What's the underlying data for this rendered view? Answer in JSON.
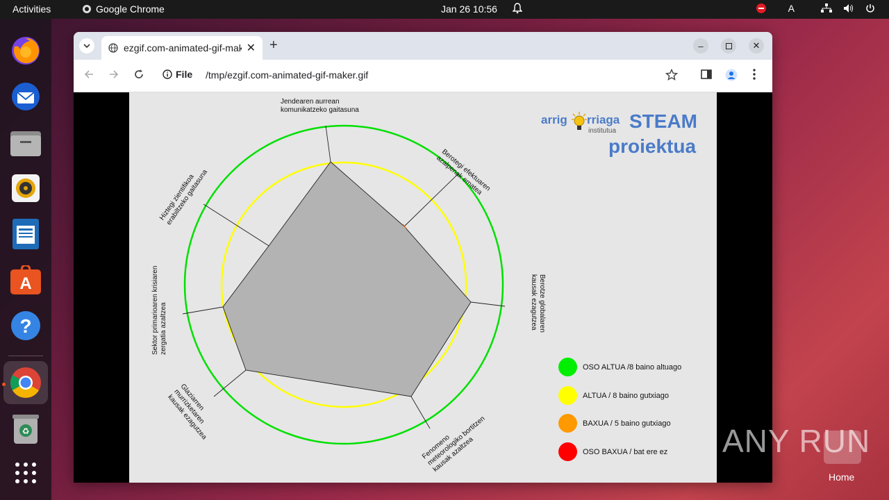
{
  "topbar": {
    "activities": "Activities",
    "app_name": "Google Chrome",
    "clock": "Jan 26  10:56",
    "lang": "A"
  },
  "dock": {
    "items": [
      "firefox-icon",
      "thunderbird-icon",
      "files-icon",
      "rhythmbox-icon",
      "writer-icon",
      "software-icon",
      "help-icon",
      "chrome-icon",
      "trash-icon",
      "apps-grid-icon"
    ]
  },
  "browser": {
    "tab_title": "ezgif.com-animated-gif-maker.gif",
    "address_label": "File",
    "address_url": "/tmp/ezgif.com-animated-gif-maker.gif"
  },
  "gif": {
    "logo_left": "arrig",
    "logo_right": "rriaga",
    "logo_sub": "institutua",
    "steam": "STEAM",
    "proiektua": "proiektua",
    "axes": [
      "Jendearen aurrean komunikatzeko gaitasuna",
      "Berotegi efektuaren azalpenak ematea",
      "Berotze globalaren kausak ezagutzea",
      "Fenomeno meteorologiko bortitzen kausak azaltzea",
      "Glaziarren murrizketaren kausak ezagutzea",
      "Sektor primarioaren krisiaren zergatia azaltzea",
      "Hiztegi zientifikoa erabiltzeko gaitasuna"
    ],
    "legend": [
      {
        "label": "OSO ALTUA /8 baino altuago",
        "color": "#00ee00"
      },
      {
        "label": "ALTUA / 8 baino gutxiago",
        "color": "#ffff00"
      },
      {
        "label": "BAXUA / 5 baino gutxiago",
        "color": "#ff9900"
      },
      {
        "label": "OSO BAXUA / bat ere ez",
        "color": "#ff0000"
      }
    ]
  },
  "watermark": {
    "text": "ANY RUN",
    "home": "Home"
  }
}
